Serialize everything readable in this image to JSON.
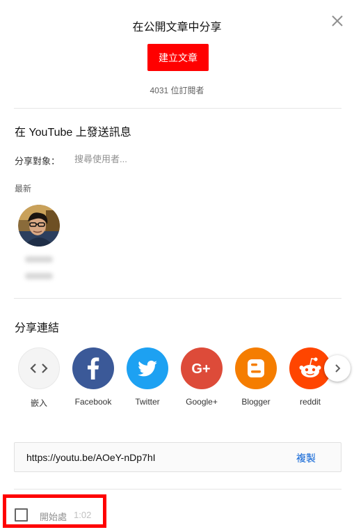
{
  "dialog": {
    "title": "在公開文章中分享",
    "create_post_label": "建立文章",
    "subscribers_text": "4031 位訂閱者",
    "close_icon": "close-icon"
  },
  "message": {
    "section_title": "在 YouTube 上發送訊息",
    "share_to_label": "分享對象：",
    "search_placeholder": "搜尋使用者...",
    "recent_label": "最新"
  },
  "share": {
    "section_title": "分享連結",
    "targets": [
      {
        "label": "嵌入",
        "icon": "embed-icon",
        "color": "#f4f4f4"
      },
      {
        "label": "Facebook",
        "icon": "facebook-icon",
        "color": "#3b5998"
      },
      {
        "label": "Twitter",
        "icon": "twitter-icon",
        "color": "#1da1f2"
      },
      {
        "label": "Google+",
        "icon": "google-plus-icon",
        "color": "#dd4b39"
      },
      {
        "label": "Blogger",
        "icon": "blogger-icon",
        "color": "#f57d00"
      },
      {
        "label": "reddit",
        "icon": "reddit-icon",
        "color": "#ff4500"
      }
    ],
    "next_icon": "chevron-right-icon"
  },
  "link": {
    "url": "https://youtu.be/AOeY-nDp7hI",
    "copy_label": "複製"
  },
  "start_at": {
    "label": "開始處",
    "time": "1:02",
    "checked": false
  },
  "colors": {
    "accent_red": "#ff0000",
    "link_blue": "#065fd4"
  }
}
